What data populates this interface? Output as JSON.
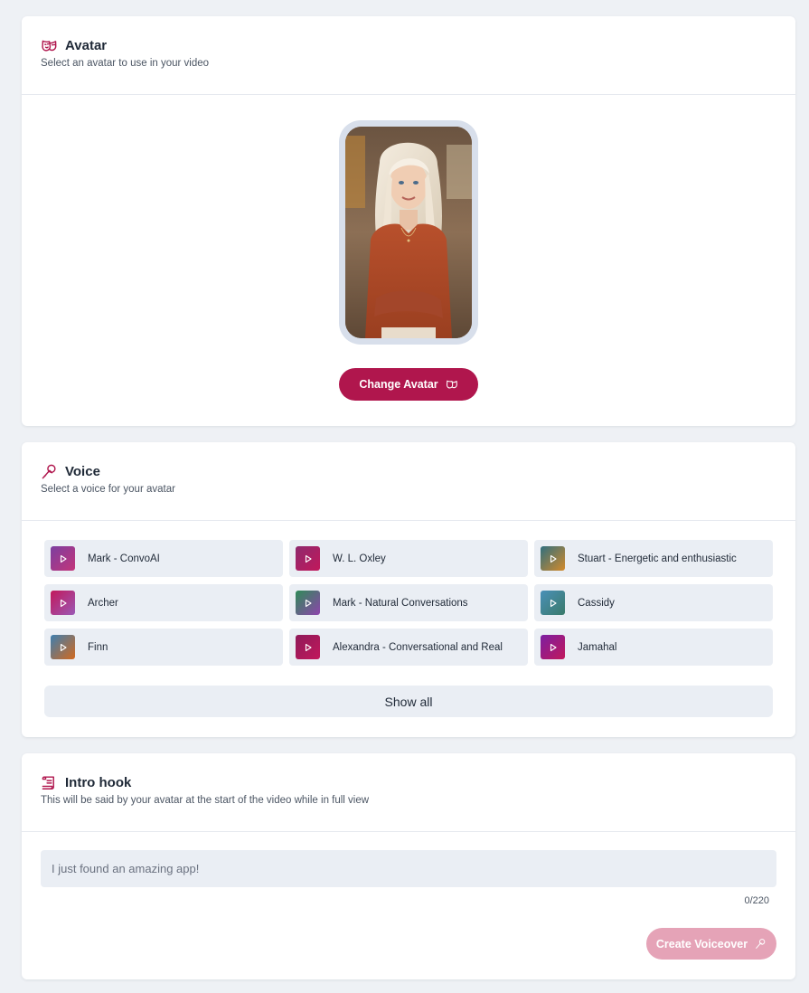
{
  "avatar_section": {
    "title": "Avatar",
    "subtitle": "Select an avatar to use in your video",
    "change_button": "Change Avatar",
    "title_icon": "masks-icon",
    "button_icon": "masks-icon"
  },
  "voice_section": {
    "title": "Voice",
    "subtitle": "Select a voice for your avatar",
    "title_icon": "microphone-icon",
    "voices": [
      {
        "name": "Mark - ConvoAI",
        "gradient": [
          "#7b3fa0",
          "#c4357a"
        ]
      },
      {
        "name": "W. L. Oxley",
        "gradient": [
          "#8e2a6e",
          "#c2185b"
        ]
      },
      {
        "name": "Stuart - Energetic and enthusiastic",
        "gradient": [
          "#2f6f7f",
          "#d48a2a"
        ]
      },
      {
        "name": "Archer",
        "gradient": [
          "#c2185b",
          "#9b59b6"
        ]
      },
      {
        "name": "Mark - Natural Conversations",
        "gradient": [
          "#2e8b57",
          "#8e44ad"
        ]
      },
      {
        "name": "Cassidy",
        "gradient": [
          "#4a90b8",
          "#3a7a6a"
        ]
      },
      {
        "name": "Finn",
        "gradient": [
          "#3d7fb0",
          "#d2691e"
        ]
      },
      {
        "name": "Alexandra - Conversational and Real",
        "gradient": [
          "#8e1a5a",
          "#c2185b"
        ]
      },
      {
        "name": "Jamahal",
        "gradient": [
          "#7b1fa2",
          "#c2185b"
        ]
      }
    ],
    "show_all": "Show all"
  },
  "intro_section": {
    "title": "Intro hook",
    "subtitle": "This will be said by your avatar at the start of the video while in full view",
    "title_icon": "scroll-icon",
    "input_placeholder": "I just found an amazing app!",
    "counter": "0/220",
    "create_button": "Create Voiceover",
    "button_icon": "microphone-icon"
  },
  "colors": {
    "brand": "#b0164d",
    "brand_disabled": "#e5a3b7",
    "background": "#eef1f5",
    "tile": "#eaeef4"
  }
}
